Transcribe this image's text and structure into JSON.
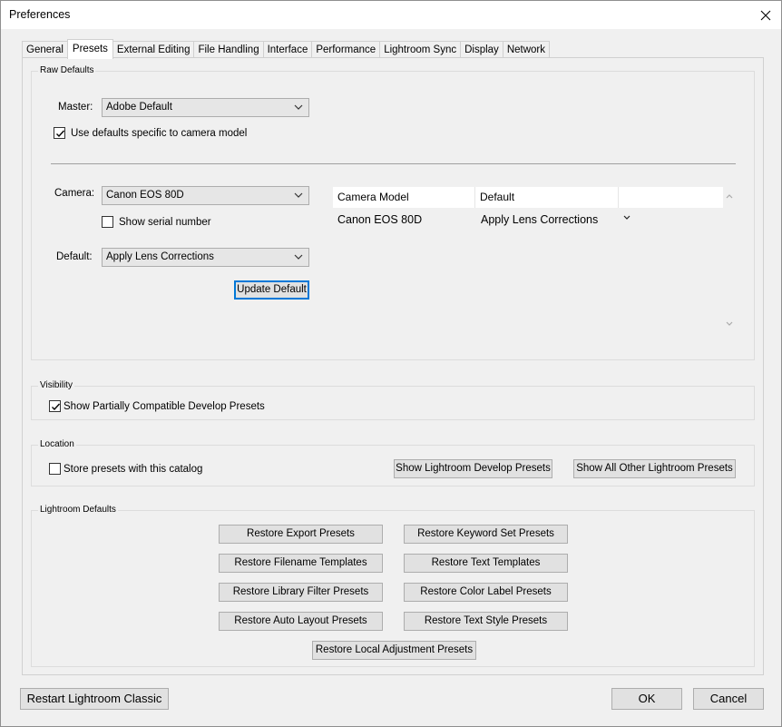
{
  "window": {
    "title": "Preferences"
  },
  "tabs": [
    "General",
    "Presets",
    "External Editing",
    "File Handling",
    "Interface",
    "Performance",
    "Lightroom Sync",
    "Display",
    "Network"
  ],
  "active_tab": "Presets",
  "raw_defaults": {
    "group_label": "Raw Defaults",
    "master_label": "Master:",
    "master_value": "Adobe Default",
    "use_camera_defaults_label": "Use defaults specific to camera model",
    "use_camera_defaults_checked": true,
    "camera_label": "Camera:",
    "camera_value": "Canon EOS 80D",
    "show_serial_label": "Show serial number",
    "show_serial_checked": false,
    "default_label": "Default:",
    "default_value": "Apply Lens Corrections",
    "update_default_label": "Update Default",
    "table": {
      "columns": [
        "Camera Model",
        "Default"
      ],
      "rows": [
        {
          "camera_model": "Canon EOS 80D",
          "default": "Apply Lens Corrections"
        }
      ]
    }
  },
  "visibility": {
    "group_label": "Visibility",
    "show_partial_label": "Show Partially Compatible Develop Presets",
    "show_partial_checked": true
  },
  "location": {
    "group_label": "Location",
    "store_with_catalog_label": "Store presets with this catalog",
    "store_with_catalog_checked": false,
    "show_develop_presets_label": "Show Lightroom Develop Presets",
    "show_other_presets_label": "Show All Other Lightroom Presets"
  },
  "lightroom_defaults": {
    "group_label": "Lightroom Defaults",
    "buttons": [
      "Restore Export Presets",
      "Restore Keyword Set Presets",
      "Restore Filename Templates",
      "Restore Text Templates",
      "Restore Library Filter Presets",
      "Restore Color Label Presets",
      "Restore Auto Layout Presets",
      "Restore Text Style Presets",
      "Restore Local Adjustment Presets"
    ]
  },
  "footer": {
    "restart_label": "Restart Lightroom Classic",
    "ok_label": "OK",
    "cancel_label": "Cancel"
  },
  "colors": {
    "focus_blue": "#0078d7",
    "button_bg": "#e1e1e1",
    "window_bg": "#f0f0f0"
  }
}
